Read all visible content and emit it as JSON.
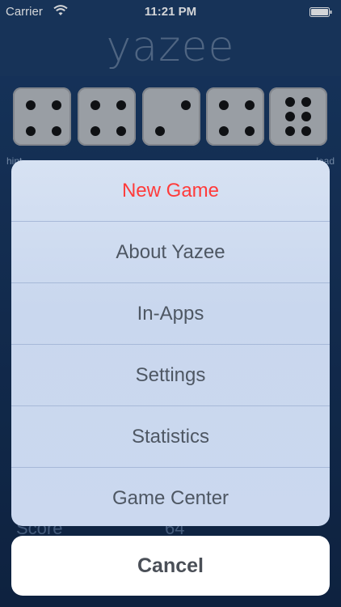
{
  "status_bar": {
    "carrier": "Carrier",
    "time": "11:21 PM"
  },
  "app": {
    "title": "yazee"
  },
  "game": {
    "dice": [
      4,
      4,
      2,
      4,
      6
    ],
    "hint_label": "hint",
    "lock_label": "lead",
    "score_label": "Score",
    "score_value": "64"
  },
  "action_sheet": {
    "items": [
      {
        "label": "New Game",
        "destructive": true
      },
      {
        "label": "About Yazee"
      },
      {
        "label": "In-Apps"
      },
      {
        "label": "Settings"
      },
      {
        "label": "Statistics"
      },
      {
        "label": "Game Center"
      }
    ],
    "cancel_label": "Cancel"
  },
  "colors": {
    "background": "#122a4b",
    "destructive": "#ff3b3b"
  }
}
